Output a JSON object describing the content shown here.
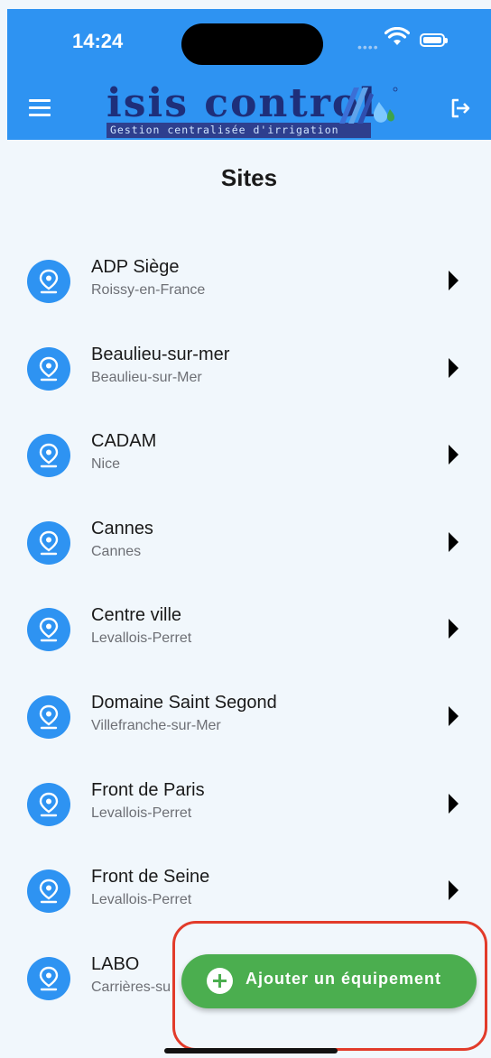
{
  "status_bar": {
    "time": "14:24"
  },
  "header": {
    "logo_title": "isis control",
    "logo_subtitle": "Gestion centralisée d'irrigation",
    "menu_icon": "hamburger-menu-icon",
    "logout_icon": "logout-icon",
    "bg_color": "#2e93f2"
  },
  "page": {
    "title": "Sites"
  },
  "sites": [
    {
      "name": "ADP Siège",
      "city": "Roissy-en-France"
    },
    {
      "name": "Beaulieu-sur-mer",
      "city": "Beaulieu-sur-Mer"
    },
    {
      "name": "CADAM",
      "city": "Nice"
    },
    {
      "name": "Cannes",
      "city": "Cannes"
    },
    {
      "name": "Centre ville",
      "city": "Levallois-Perret"
    },
    {
      "name": "Domaine Saint Segond",
      "city": "Villefranche-sur-Mer"
    },
    {
      "name": "Front de Paris",
      "city": "Levallois-Perret"
    },
    {
      "name": "Front de Seine",
      "city": "Levallois-Perret"
    },
    {
      "name": "LABO",
      "city": "Carrières-su"
    }
  ],
  "fab": {
    "label": "Ajouter un équipement",
    "color": "#4bae4f"
  }
}
